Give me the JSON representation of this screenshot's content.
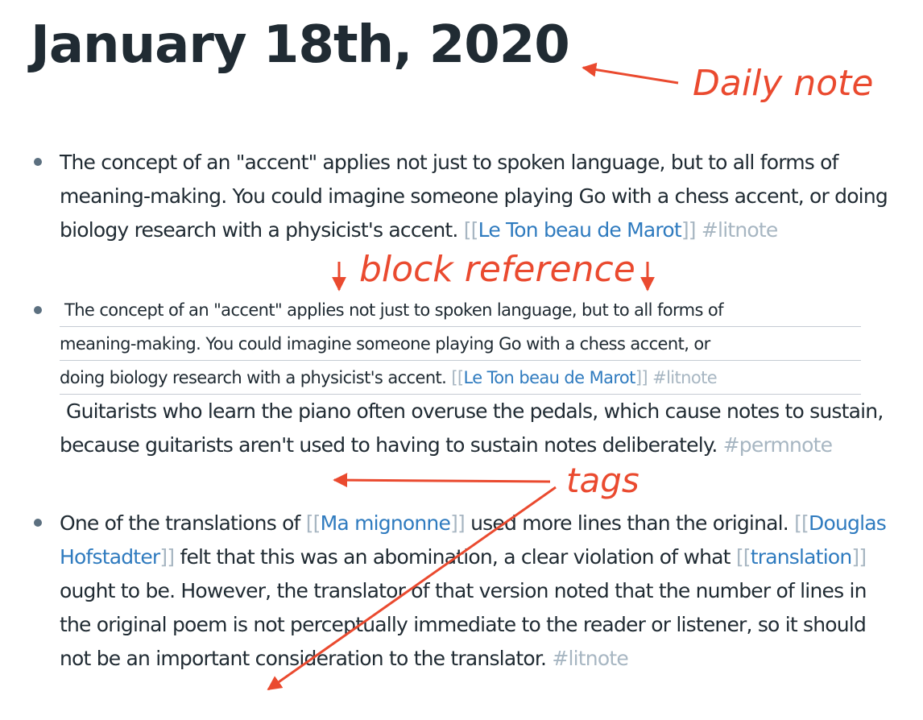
{
  "page": {
    "title": "January 18th, 2020"
  },
  "blocks": [
    {
      "text_a": "The concept of an \"accent\" applies not just to spoken language, but to all forms of meaning-making. You could imagine someone playing Go with a chess accent, or doing biology research with a physicist's accent.",
      "link": "Le Ton beau de Marot",
      "tag": "#litnote"
    },
    {
      "ref_lines": [
        "The concept of an \"accent\" applies not just to spoken language, but to all forms of",
        "meaning-making. You could imagine someone playing Go with a chess accent, or",
        "doing biology research with a physicist's accent."
      ],
      "ref_link": "Le Ton beau de Marot",
      "ref_tag": "#litnote",
      "after_text": "Guitarists who learn the piano often overuse the pedals, which cause notes to sustain, because guitarists aren't used to having to sustain notes deliberately.",
      "after_tag": "#permnote"
    },
    {
      "t1": "One of the translations of",
      "link1": "Ma mignonne",
      "t2": "used more lines than the original.",
      "link2": "Douglas Hofstadter",
      "t3": "felt that this was an abomination, a clear violation of what",
      "link3": "translation",
      "t4": "ought to be. However, the translator of that version noted that the number of lines in the original poem is not perceptually immediate to the reader or listener, so it should not be an important consideration to the translator.",
      "tag": "#litnote"
    }
  ],
  "annotations": {
    "daily_note": "Daily note",
    "block_reference": "block reference",
    "tags": "tags",
    "color": "#ea4a2f"
  },
  "brackets": {
    "open": "[[",
    "close": "]]"
  }
}
